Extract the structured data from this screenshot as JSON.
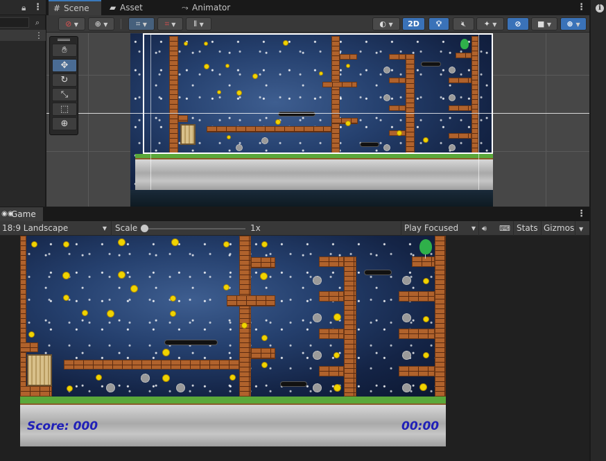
{
  "left_panel": {
    "kebab": "⋮"
  },
  "scene": {
    "tabs": [
      {
        "label": "Scene",
        "icon": "grid-icon"
      },
      {
        "label": "Asset Store",
        "icon": "store-icon"
      },
      {
        "label": "Animator",
        "icon": "animator-icon"
      }
    ],
    "toolbar": {
      "mode_2d": "2D"
    },
    "tools": [
      "hand-tool",
      "move-tool",
      "rotate-tool",
      "scale-tool",
      "rect-tool",
      "transform-tool"
    ]
  },
  "game": {
    "tab_label": "Game",
    "aspect": "18:9 Landscape",
    "scale_label": "Scale",
    "scale_value": "1x",
    "play_mode": "Play Focused",
    "stats": "Stats",
    "gizmos": "Gizmos",
    "hud": {
      "score": "Score: 000",
      "timer": "00:00"
    }
  },
  "colors": {
    "accent": "#3a79bb",
    "hud_text": "#2020b8"
  }
}
